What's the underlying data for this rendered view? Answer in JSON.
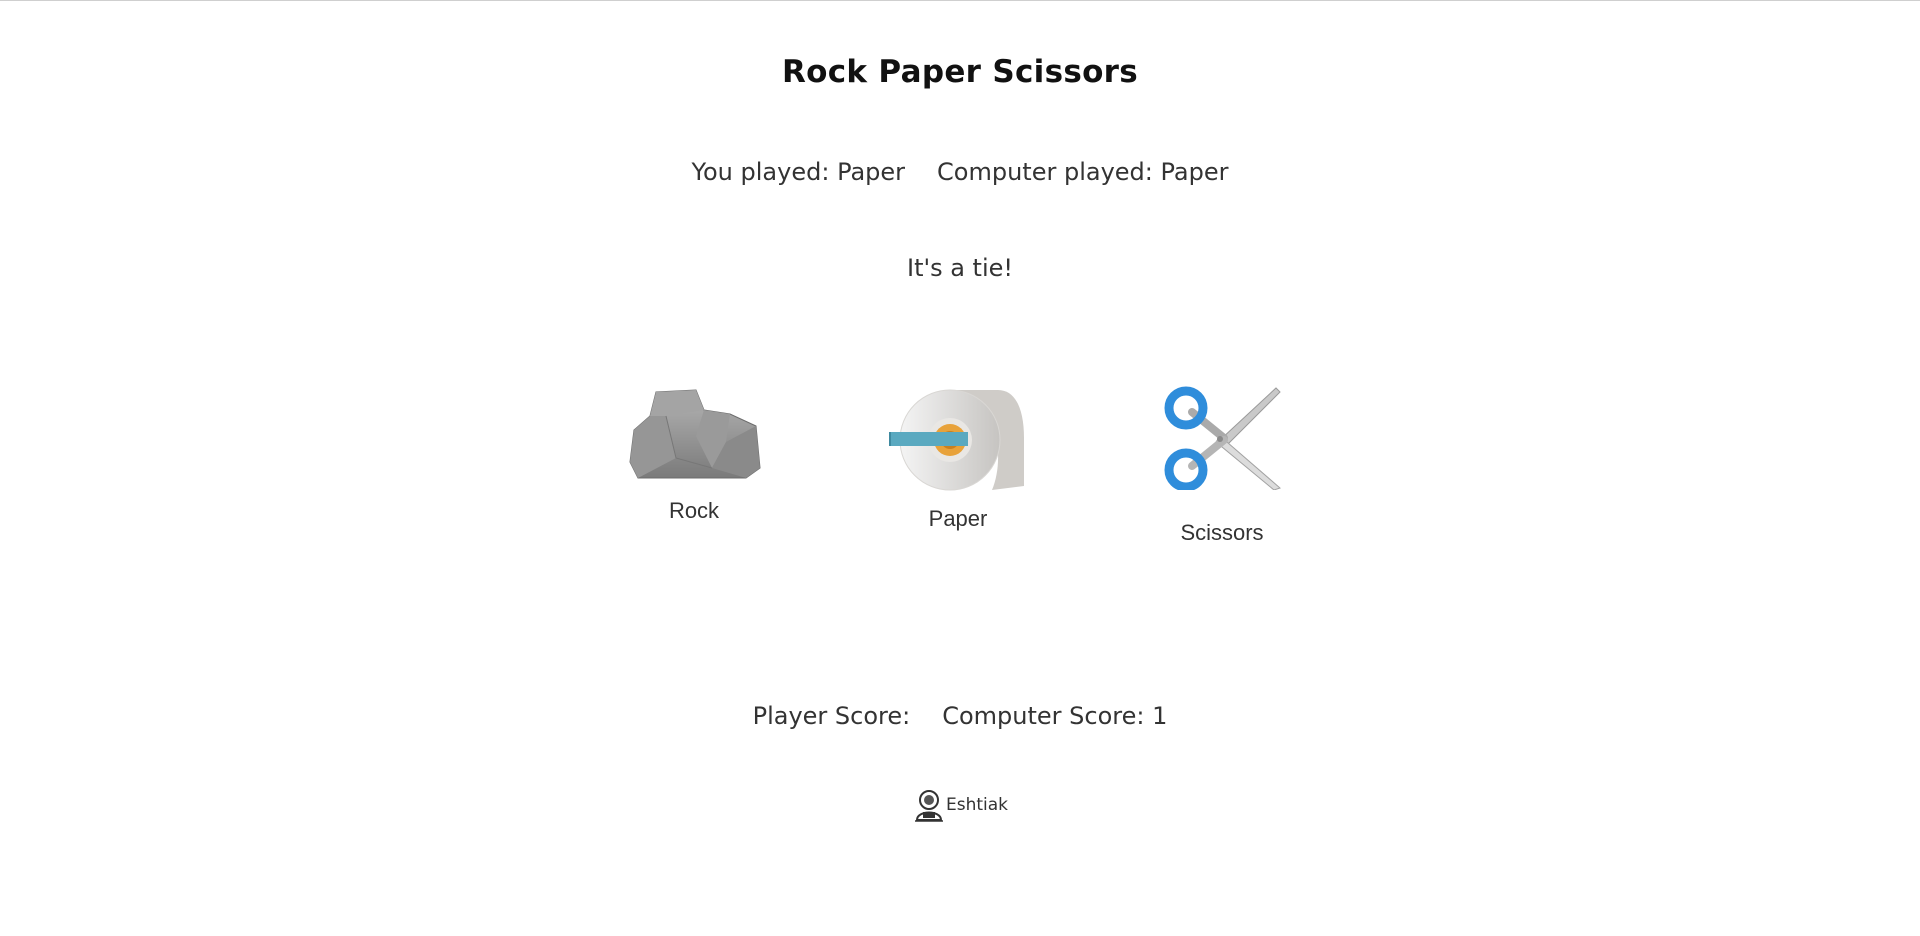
{
  "title": "Rock Paper Scissors",
  "plays": {
    "player_prefix": "You played:",
    "player_choice": "Paper",
    "computer_prefix": "Computer played:",
    "computer_choice": "Paper"
  },
  "result": "It's a tie!",
  "choices": [
    {
      "label": "Rock",
      "icon": "rock-icon"
    },
    {
      "label": "Paper",
      "icon": "toilet-paper-icon"
    },
    {
      "label": "Scissors",
      "icon": "scissors-icon"
    }
  ],
  "scores": {
    "player_label": "Player Score:",
    "player_value": "",
    "computer_label": "Computer Score:",
    "computer_value": "1"
  },
  "credit": {
    "name": "Eshtiak",
    "icon": "astronaut-avatar-icon"
  },
  "colors": {
    "scissors_handle": "#2f8ddb",
    "paper_core": "#e8a23a",
    "paper_strip": "#5aa9c0",
    "rock": "#8f8f8f"
  }
}
